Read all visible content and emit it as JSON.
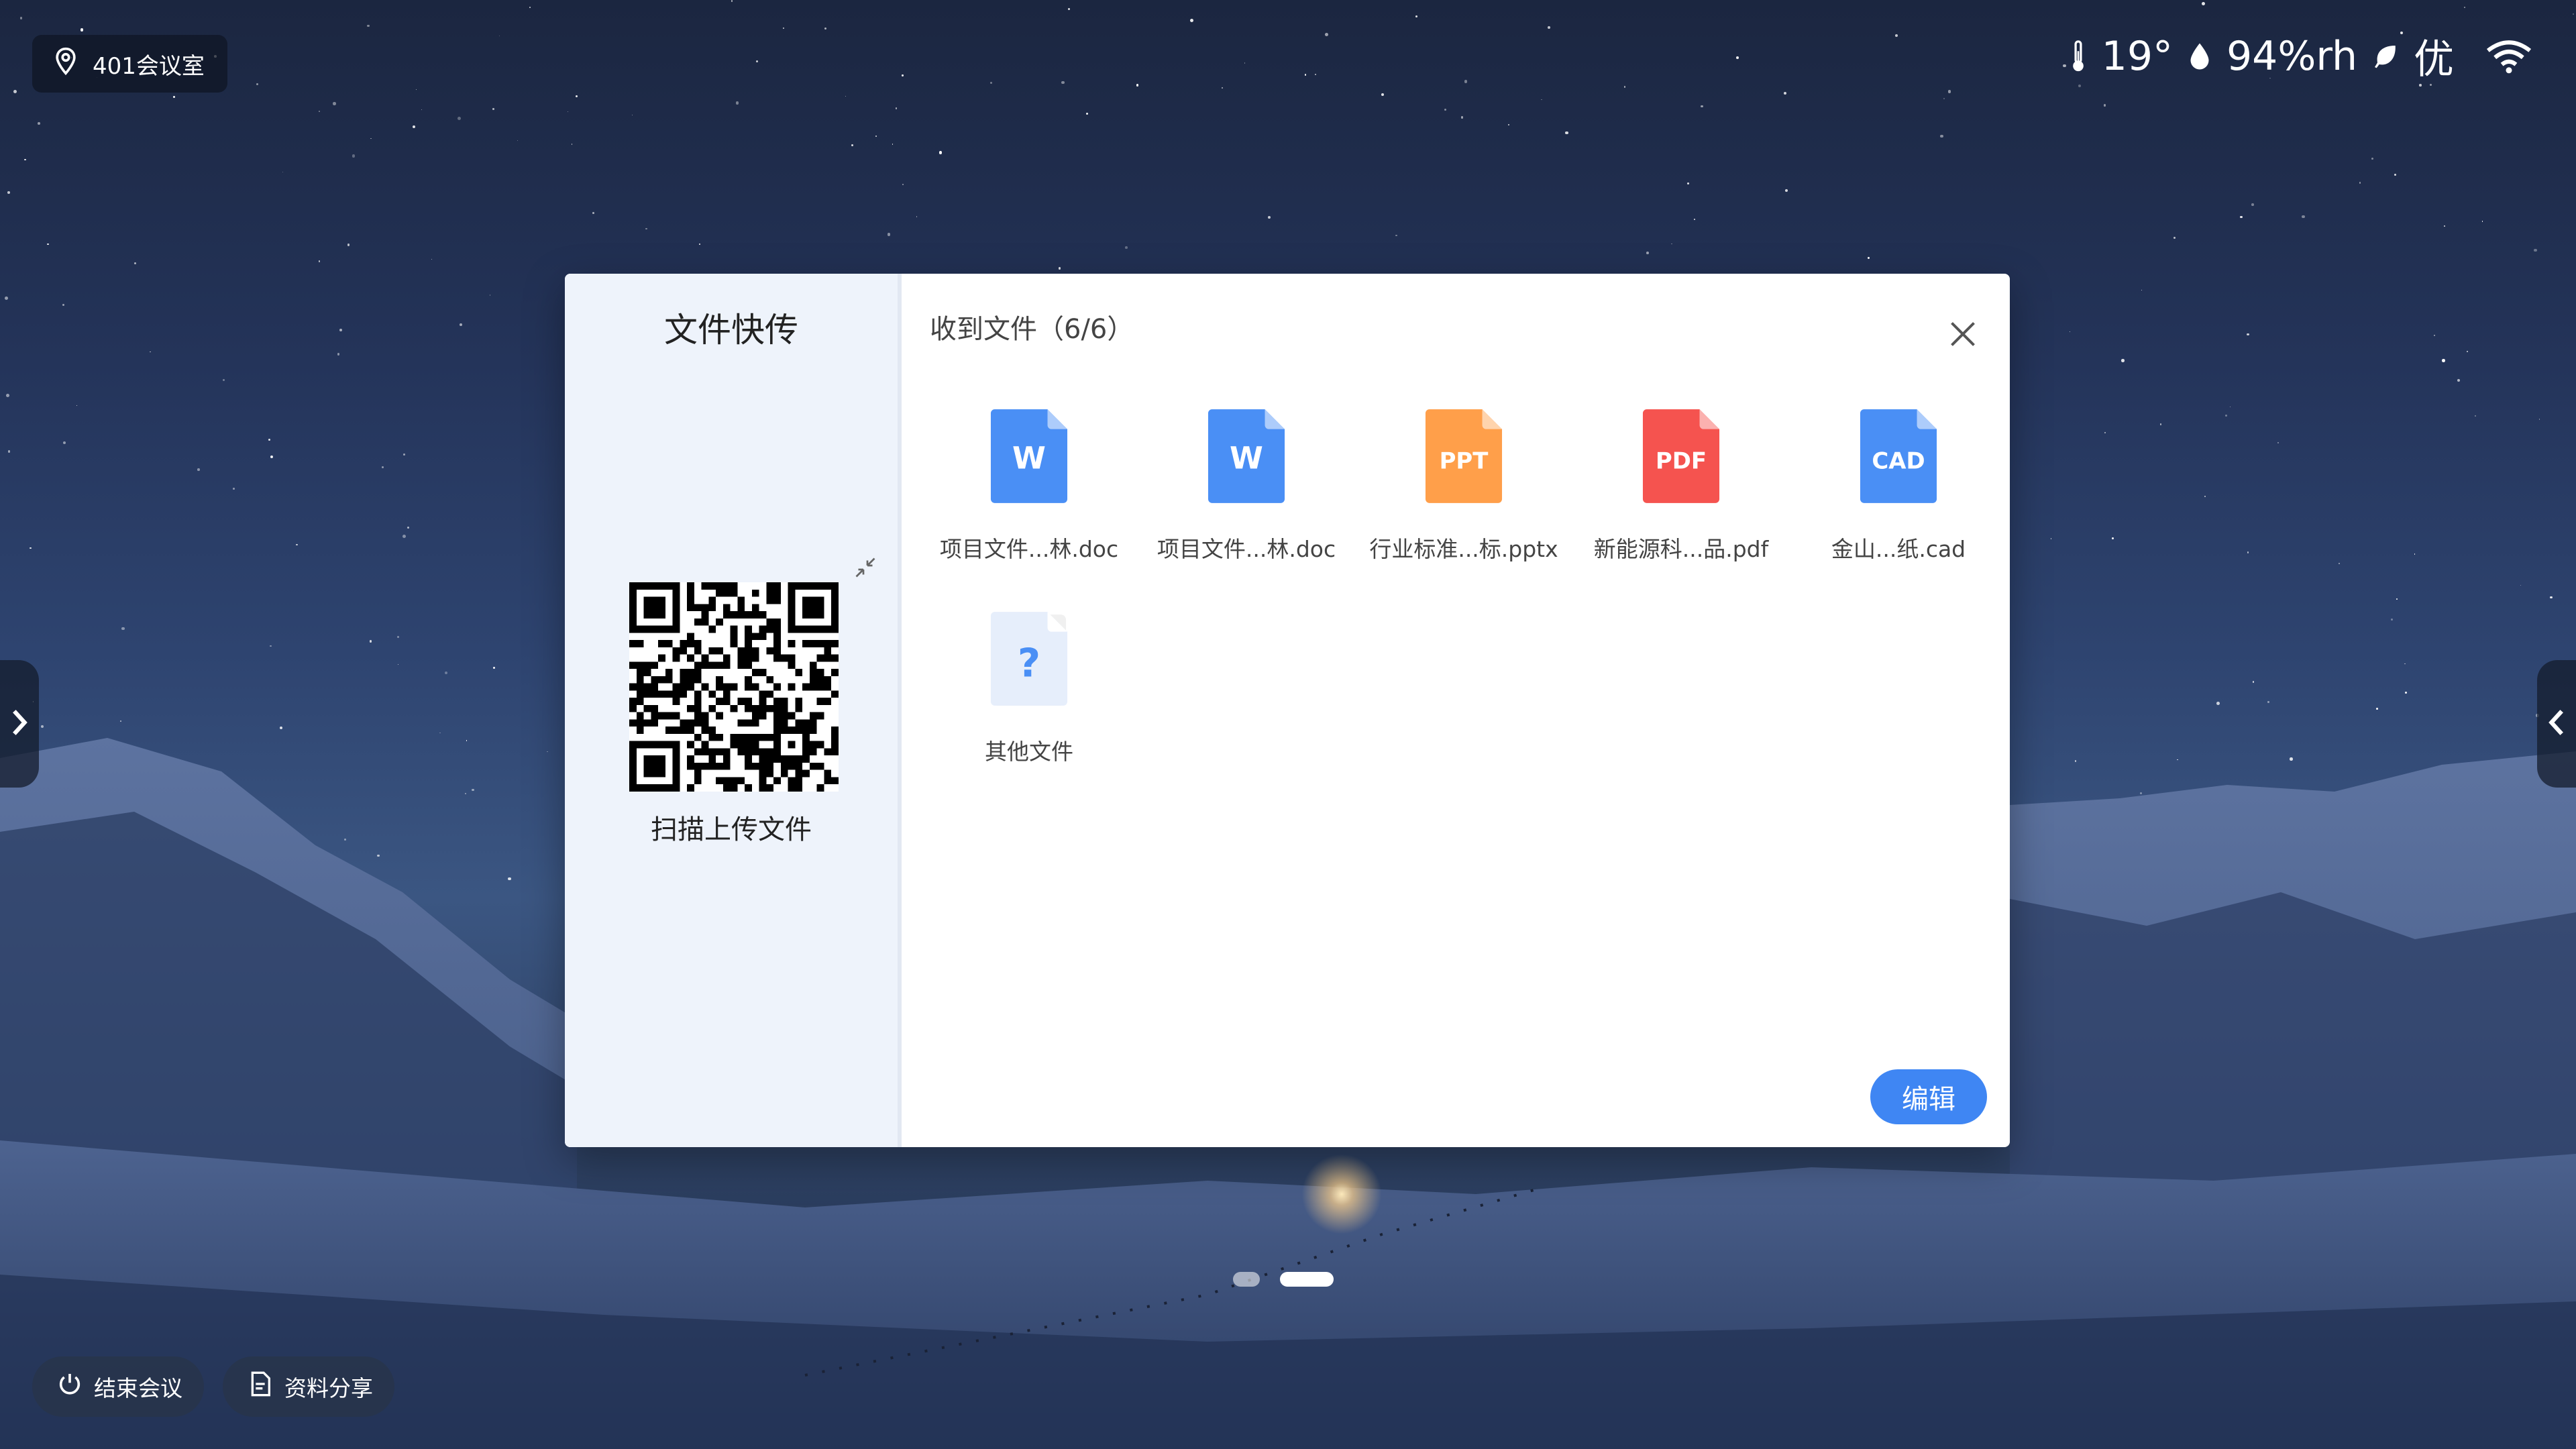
{
  "location": {
    "label": "401会议室"
  },
  "status": {
    "temperature": "19°",
    "humidity": "94%rh",
    "air_quality": "优"
  },
  "dialog": {
    "left_title": "文件快传",
    "qr_label": "扫描上传文件",
    "right_title": "收到文件（6/6）",
    "edit_label": "编辑",
    "files": [
      {
        "name": "项目文件...林.doc",
        "type": "W",
        "color": "#4a8ff5"
      },
      {
        "name": "项目文件...林.doc",
        "type": "W",
        "color": "#4a8ff5"
      },
      {
        "name": "行业标准...标.pptx",
        "type": "PPT",
        "color": "#ff9f4a"
      },
      {
        "name": "新能源科...品.pdf",
        "type": "PDF",
        "color": "#f5534f"
      },
      {
        "name": "金山...纸.cad",
        "type": "CAD",
        "color": "#4a8ff5"
      },
      {
        "name": "其他文件",
        "type": "?",
        "color": "#e6eefb"
      }
    ]
  },
  "pager": {
    "count": 2,
    "active": 2
  },
  "bottom": {
    "end_meeting": "结束会议",
    "share_material": "资料分享"
  }
}
